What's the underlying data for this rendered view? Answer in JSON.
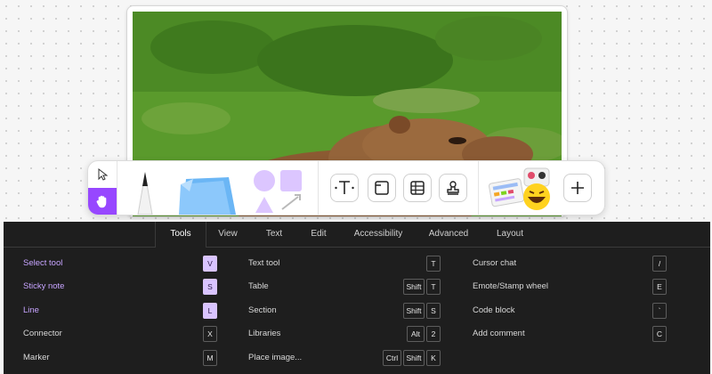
{
  "photo": {
    "subject": "capybara on grass",
    "colors": {
      "grass": "#5a9a2c",
      "fur": "#8b5a32"
    }
  },
  "toolbar": {
    "move_tool": "move-cursor-icon",
    "hand_tool": "hand-icon",
    "accent": "#9747ff",
    "text_tool": "T",
    "stickers_label": "Connect"
  },
  "panel": {
    "tabs": [
      "Tools",
      "View",
      "Text",
      "Edit",
      "Accessibility",
      "Advanced",
      "Layout"
    ],
    "active_tab": "Tools",
    "columns": [
      [
        {
          "label": "Select tool",
          "keys": [
            "V"
          ],
          "highlight": true
        },
        {
          "label": "Sticky note",
          "keys": [
            "S"
          ],
          "highlight": true
        },
        {
          "label": "Line",
          "keys": [
            "L"
          ],
          "highlight": true
        },
        {
          "label": "Connector",
          "keys": [
            "X"
          ],
          "highlight": false
        },
        {
          "label": "Marker",
          "keys": [
            "M"
          ],
          "highlight": false
        }
      ],
      [
        {
          "label": "Text tool",
          "keys": [
            "T"
          ],
          "highlight": false
        },
        {
          "label": "Table",
          "keys": [
            "Shift",
            "T"
          ],
          "highlight": false
        },
        {
          "label": "Section",
          "keys": [
            "Shift",
            "S"
          ],
          "highlight": false
        },
        {
          "label": "Libraries",
          "keys": [
            "Alt",
            "2"
          ],
          "highlight": false
        },
        {
          "label": "Place image...",
          "keys": [
            "Ctrl",
            "Shift",
            "K"
          ],
          "highlight": false
        }
      ],
      [
        {
          "label": "Cursor chat",
          "keys": [
            "/"
          ],
          "highlight": false
        },
        {
          "label": "Emote/Stamp wheel",
          "keys": [
            "E"
          ],
          "highlight": false
        },
        {
          "label": "Code block",
          "keys": [
            "`"
          ],
          "highlight": false
        },
        {
          "label": "Add comment",
          "keys": [
            "C"
          ],
          "highlight": false
        }
      ]
    ]
  }
}
